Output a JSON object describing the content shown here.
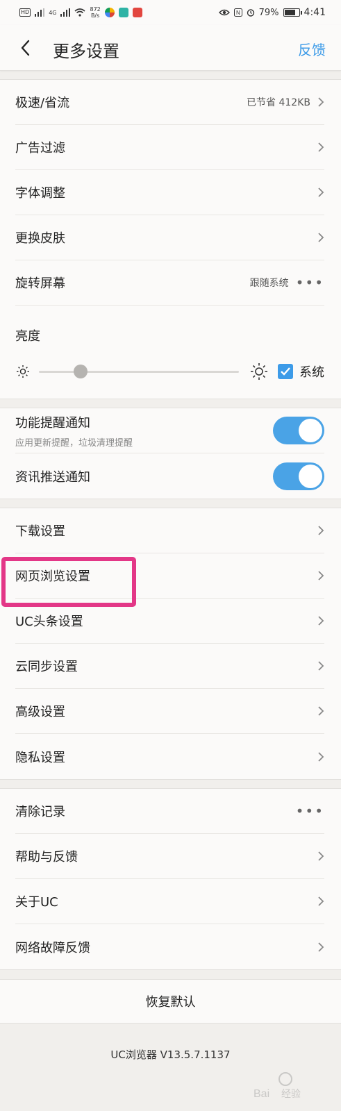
{
  "status_bar": {
    "left_chips": [
      "HD",
      "4G"
    ],
    "speed_value": "872",
    "speed_unit": "B/s",
    "battery": "79%",
    "time": "4:41"
  },
  "header": {
    "title": "更多设置",
    "feedback_label": "反馈"
  },
  "group1": {
    "speed_label": "极速/省流",
    "speed_value": "已节省 412KB",
    "adblock_label": "广告过滤",
    "font_label": "字体调整",
    "skin_label": "更换皮肤",
    "rotate_label": "旋转屏幕",
    "rotate_value": "跟随系统",
    "brightness_label": "亮度",
    "brightness_level": 0.21,
    "brightness_system_label": "系统",
    "brightness_system_checked": true
  },
  "group2": {
    "feature_notify_label": "功能提醒通知",
    "feature_notify_sub": "应用更新提醒，垃圾清理提醒",
    "feature_notify_on": true,
    "news_push_label": "资讯推送通知",
    "news_push_on": true
  },
  "group3": {
    "items": [
      "下载设置",
      "网页浏览设置",
      "UC头条设置",
      "云同步设置",
      "高级设置",
      "隐私设置"
    ]
  },
  "group4": {
    "clear_label": "清除记录",
    "help_label": "帮助与反馈",
    "about_label": "关于UC",
    "netfault_label": "网络故障反馈"
  },
  "restore_label": "恢复默认",
  "version": "UC浏览器 V13.5.7.1137",
  "watermark_text": "Bai 经验",
  "colors": {
    "accent": "#3d9be8",
    "toggle_on": "#4aa3e6",
    "highlight": "#e33787",
    "background": "#f1efec",
    "card": "#fbfaf9"
  }
}
